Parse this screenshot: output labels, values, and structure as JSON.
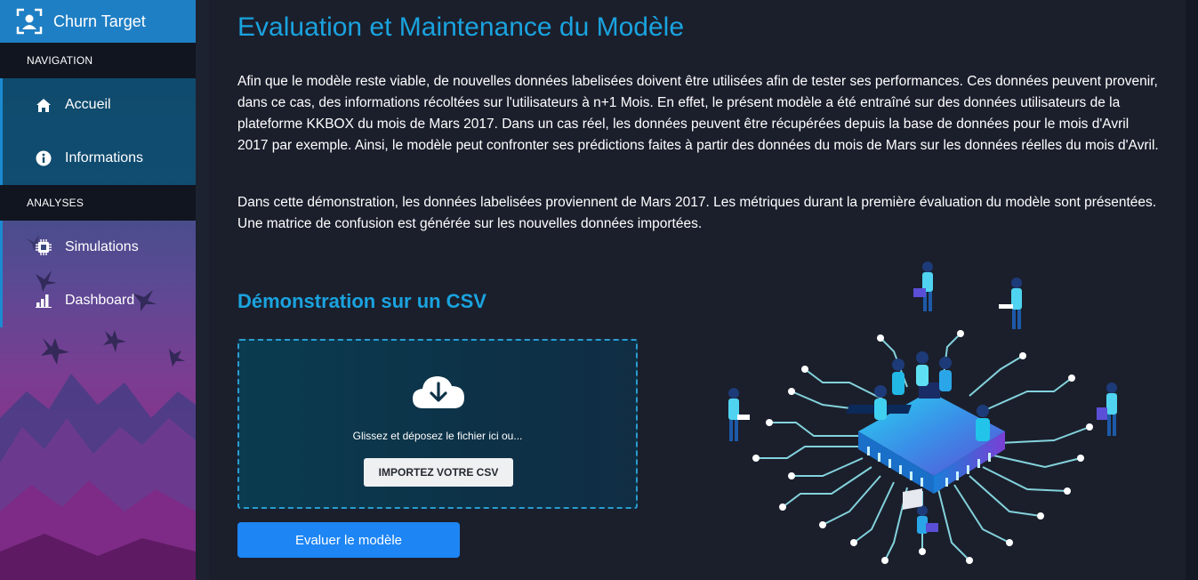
{
  "brand": {
    "name": "Churn Target",
    "icon": "user-scan-icon"
  },
  "sidebar": {
    "sections": [
      {
        "label": "NAVIGATION",
        "items": [
          {
            "label": "Accueil",
            "icon": "home-icon"
          },
          {
            "label": "Informations",
            "icon": "info-circle-icon"
          }
        ]
      },
      {
        "label": "ANALYSES",
        "items": [
          {
            "label": "Simulations",
            "icon": "chip-icon"
          },
          {
            "label": "Dashboard",
            "icon": "bar-chart-icon"
          }
        ]
      }
    ]
  },
  "main": {
    "title": "Evaluation et Maintenance du Modèle",
    "paragraph1": "Afin que le modèle reste viable, de nouvelles données labelisées doivent être utilisées afin de tester ses performances. Ces données peuvent provenir, dans ce cas, des informations récoltées sur l'utilisateurs à n+1 Mois. En effet, le présent modèle a été entraîné sur des données utilisateurs de la plateforme KKBOX du mois de Mars 2017. Dans un cas réel, les données peuvent être récupérées depuis la base de données pour le mois d'Avril 2017 par exemple. Ainsi, le modèle peut confronter ses prédictions faites à partir des données du mois de Mars sur les données réelles du mois d'Avril.",
    "paragraph2": "Dans cette démonstration, les données labelisées proviennent de Mars 2017. Les métriques durant la première évaluation du modèle sont présentées. Une matrice de confusion est générée sur les nouvelles données importées.",
    "subtitle": "Démonstration sur un CSV",
    "dropzone": {
      "icon": "cloud-download-icon",
      "text": "Glissez et déposez le fichier ici ou...",
      "button_label": "IMPORTEZ VOTRE CSV"
    },
    "evaluate_button": "Evaluer le modèle",
    "illustration": "circuit-chip-team-illustration"
  },
  "colors": {
    "accent": "#1aa3df",
    "brand_bar": "#1f7fc4",
    "primary_button": "#1d85f4",
    "background": "#1b1f2c"
  }
}
